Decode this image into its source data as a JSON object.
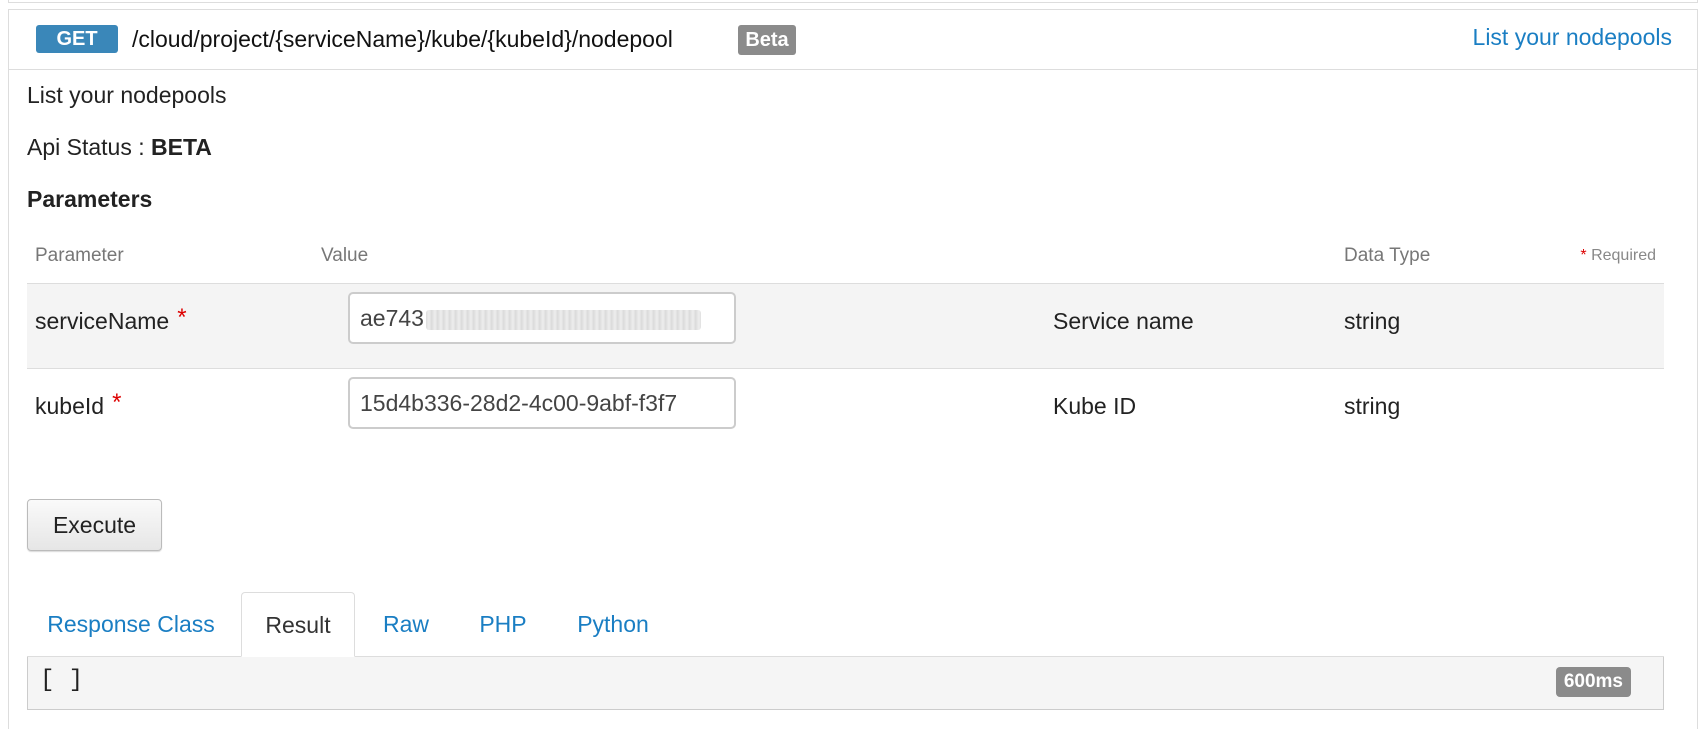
{
  "endpoint": {
    "method": "GET",
    "path": "/cloud/project/{serviceName}/kube/{kubeId}/nodepool",
    "badge": "Beta",
    "summary_link": "List your nodepools"
  },
  "description": "List your nodepools",
  "api_status": {
    "label": "Api Status : ",
    "value": "BETA"
  },
  "parameters": {
    "heading": "Parameters",
    "columns": {
      "parameter": "Parameter",
      "value": "Value",
      "data_type": "Data Type",
      "required_star": "*",
      "required_label": " Required"
    },
    "rows": [
      {
        "name": "serviceName",
        "required_mark": "*",
        "value_visible": "ae743",
        "description": "Service name",
        "type": "string"
      },
      {
        "name": "kubeId",
        "required_mark": "*",
        "value": "15d4b336-28d2-4c00-9abf-f3f7",
        "description": "Kube ID",
        "type": "string"
      }
    ]
  },
  "execute_label": "Execute",
  "tabs": [
    {
      "label": "Response Class",
      "active": false
    },
    {
      "label": "Result",
      "active": true
    },
    {
      "label": "Raw",
      "active": false
    },
    {
      "label": "PHP",
      "active": false
    },
    {
      "label": "Python",
      "active": false
    }
  ],
  "result": {
    "body": "[ ]",
    "timing": "600ms"
  },
  "colors": {
    "method_get": "#3a87b9",
    "badge_gray": "#8b8b8b",
    "link_blue": "#1a7ec3",
    "required_red": "#d00000"
  }
}
